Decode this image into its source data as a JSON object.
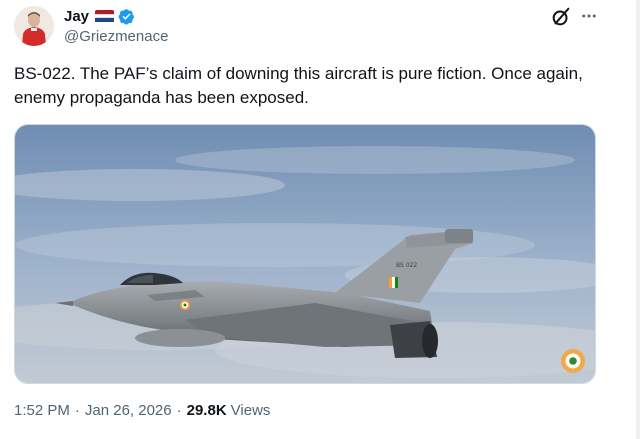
{
  "author": {
    "display_name": "Jay",
    "handle": "@Griezmenace",
    "flag_icon": "netherlands-flag-icon",
    "verified_icon": "verified-badge-icon",
    "avatar_icon": "avatar"
  },
  "header_actions": {
    "grok_icon": "grok-icon",
    "more_icon": "more-options-icon"
  },
  "tweet": {
    "text": "BS-022. The PAF’s claim of downing this aircraft is pure fiction. Once again, enemy propaganda has been exposed."
  },
  "media": {
    "tail_code": "BS 022",
    "description_icon": "fighter-jet-image"
  },
  "meta": {
    "time": "1:52 PM",
    "separator": "·",
    "date": "Jan 26, 2026",
    "views_count": "29.8K",
    "views_label": "Views"
  },
  "colors": {
    "verified_blue": "#1d9bf0",
    "secondary_text": "#536471",
    "primary_text": "#0f1419"
  }
}
